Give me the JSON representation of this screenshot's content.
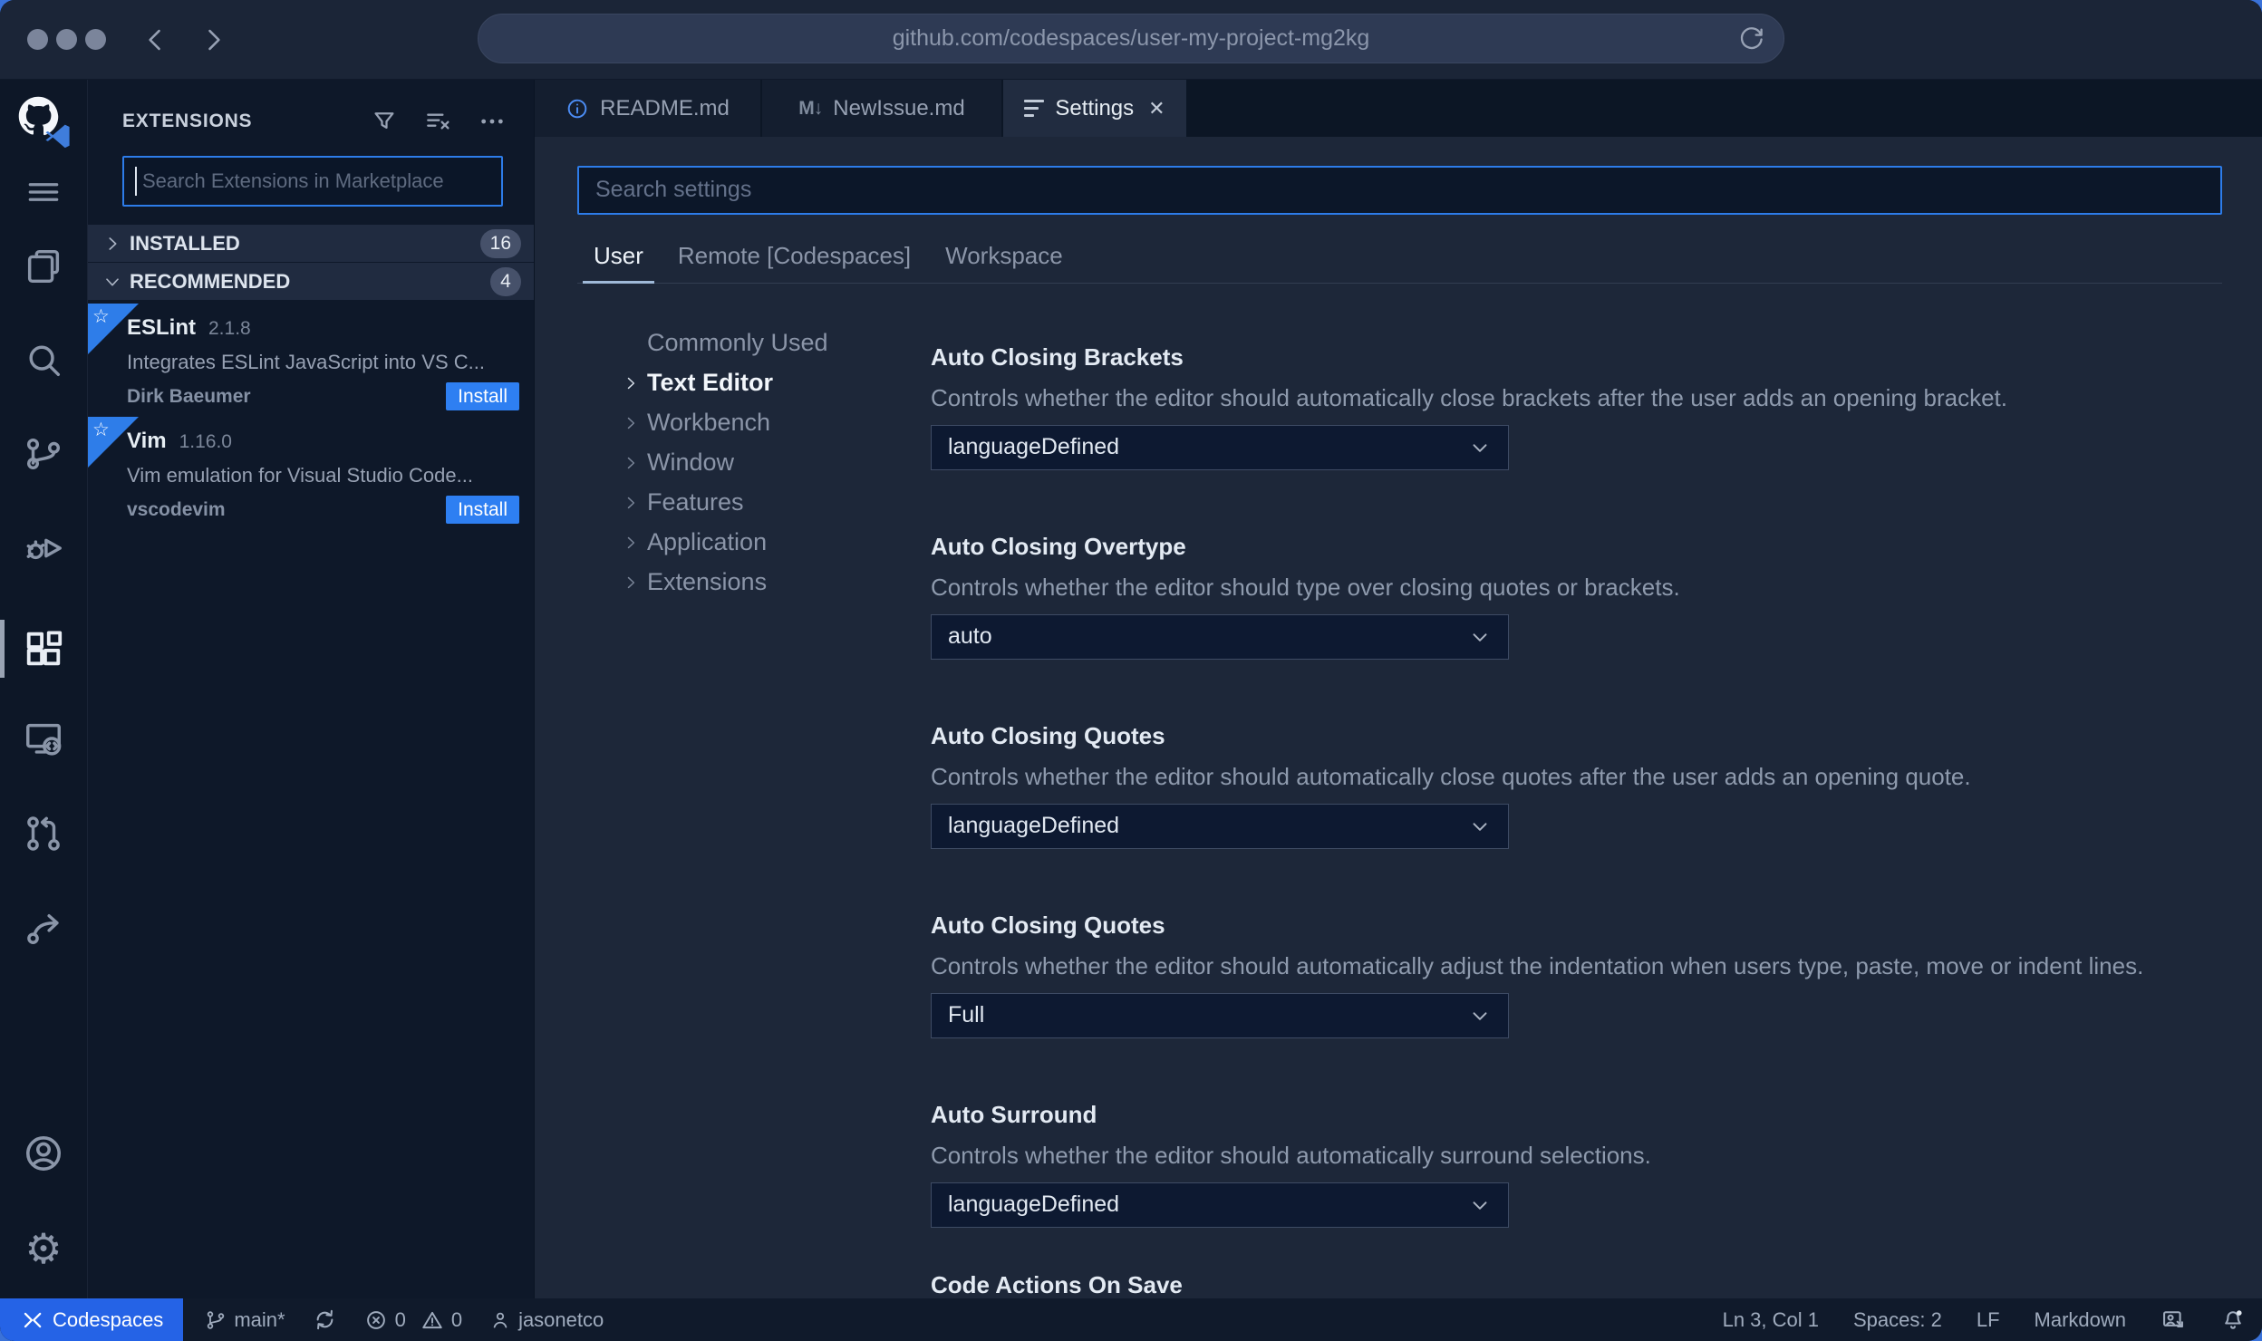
{
  "browser": {
    "url": "github.com/codespaces/user-my-project-mg2kg"
  },
  "glyphs": {
    "markdown_icon": "M↓",
    "close_icon": "✕",
    "gear_icon": "⚙",
    "star": "☆"
  },
  "activity_bar": {
    "icons": [
      "github-codespaces-logo",
      "menu",
      "explorer",
      "search",
      "source-control",
      "run-debug",
      "extensions",
      "remote-explorer",
      "pull-requests",
      "live-share",
      "account",
      "settings-gear"
    ],
    "active_icon": "extensions"
  },
  "extensions_panel": {
    "title": "EXTENSIONS",
    "search_placeholder": "Search Extensions in Marketplace",
    "sections": [
      {
        "label": "INSTALLED",
        "count": "16",
        "expanded": false
      },
      {
        "label": "RECOMMENDED",
        "count": "4",
        "expanded": true
      }
    ],
    "items": [
      {
        "name": "ESLint",
        "version": "2.1.8",
        "description": "Integrates ESLint JavaScript into VS C...",
        "publisher": "Dirk Baeumer",
        "action": "Install"
      },
      {
        "name": "Vim",
        "version": "1.16.0",
        "description": "Vim emulation for Visual Studio Code...",
        "publisher": "vscodevim",
        "action": "Install"
      }
    ]
  },
  "editor_tabs": [
    {
      "label": "README.md",
      "icon": "info-icon"
    },
    {
      "label": "NewIssue.md",
      "icon": "markdown-icon"
    },
    {
      "label": "Settings",
      "icon": "settings-editor-icon",
      "active": true
    }
  ],
  "settings_editor": {
    "search_placeholder": "Search settings",
    "scopes": [
      {
        "label": "User",
        "active": true
      },
      {
        "label": "Remote [Codespaces]",
        "active": false
      },
      {
        "label": "Workspace",
        "active": false
      }
    ],
    "toc": [
      "Commonly Used",
      "Text Editor",
      "Workbench",
      "Window",
      "Features",
      "Application",
      "Extensions"
    ],
    "active_toc": "Text Editor",
    "items": [
      {
        "title": "Auto Closing Brackets",
        "description": "Controls whether the editor should automatically close brackets after the user adds an opening bracket.",
        "value": "languageDefined"
      },
      {
        "title": "Auto Closing Overtype",
        "description": "Controls whether the editor should type over closing quotes or brackets.",
        "value": "auto"
      },
      {
        "title": "Auto Closing Quotes",
        "description": "Controls whether the editor should automatically close quotes after the user adds an opening quote.",
        "value": "languageDefined"
      },
      {
        "title": "Auto Closing Quotes",
        "description": "Controls whether the editor should automatically adjust the indentation when users type, paste, move or indent lines.",
        "value": "Full"
      },
      {
        "title": "Auto Surround",
        "description": "Controls whether the editor should automatically surround selections.",
        "value": "languageDefined"
      },
      {
        "title": "Code Actions On Save"
      }
    ]
  },
  "status_bar": {
    "remote_label": "Codespaces",
    "branch": "main*",
    "errors": "0",
    "warnings": "0",
    "user": "jasonetco",
    "line_col": "Ln 3, Col 1",
    "indent": "Spaces: 2",
    "eol": "LF",
    "language": "Markdown"
  },
  "colors": {
    "accent_blue": "#2d7ce9",
    "install_blue": "#2e7ff2",
    "codespaces_blue": "#2563e6",
    "badge_bg": "#46516a",
    "editor_bg": "#1d2739",
    "panel_bg": "#0e1829",
    "titlebar_bg": "#1b2537",
    "statusbar_bg": "#101a2b"
  }
}
